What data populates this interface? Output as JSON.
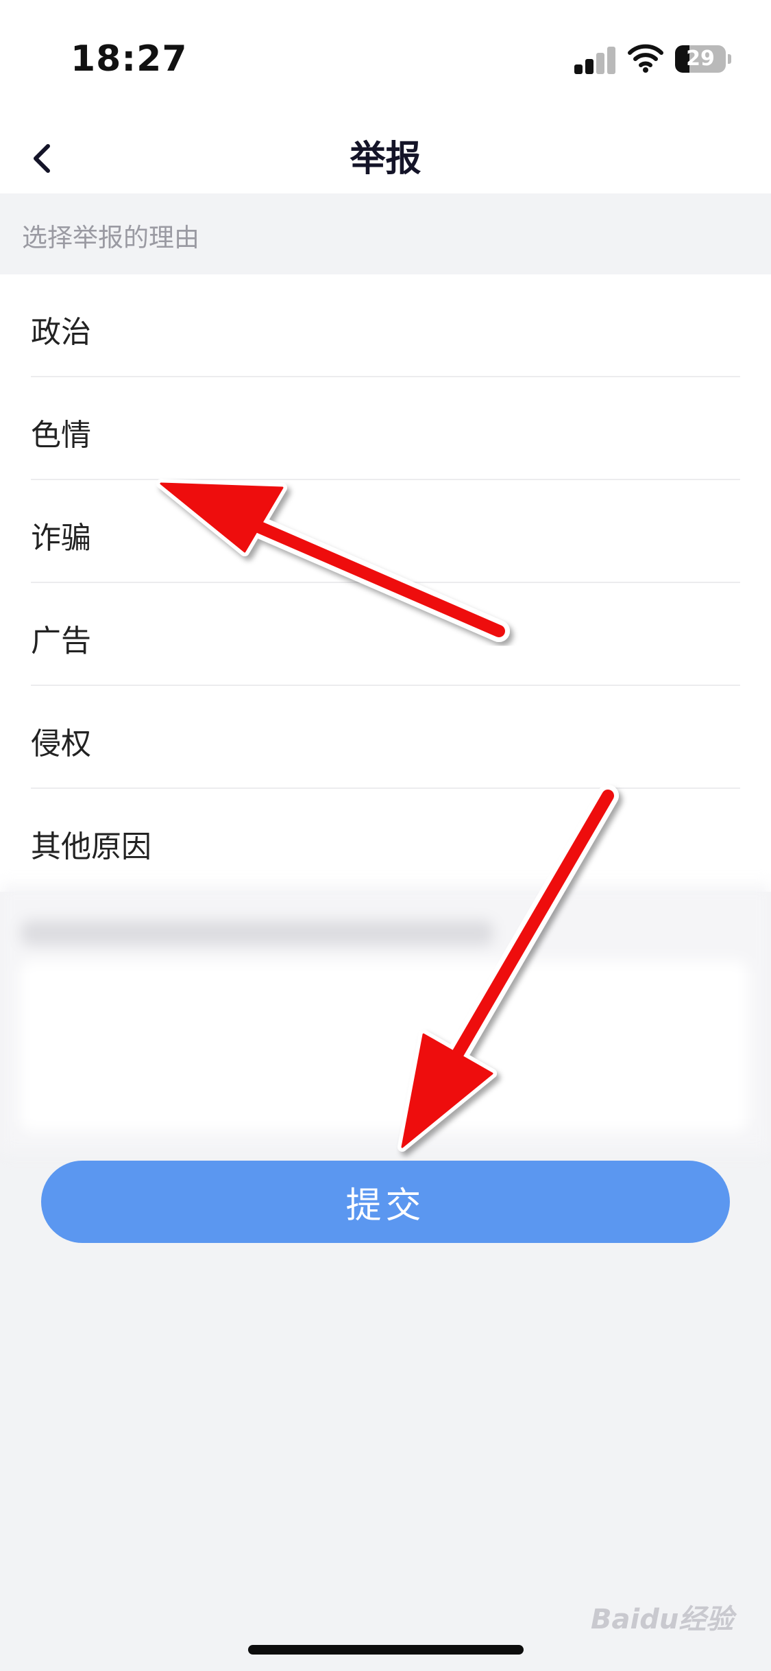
{
  "status_bar": {
    "time": "18:27",
    "battery_level": "29",
    "signal_icon": "signal-icon",
    "wifi_icon": "wifi-icon",
    "battery_icon": "battery-icon"
  },
  "nav": {
    "title": "举报",
    "back_icon": "chevron-left-icon"
  },
  "section_hint": "选择举报的理由",
  "reasons": [
    {
      "label": "政治"
    },
    {
      "label": "色情"
    },
    {
      "label": "诈骗"
    },
    {
      "label": "广告"
    },
    {
      "label": "侵权"
    },
    {
      "label": "其他原因"
    }
  ],
  "submit_label": "提交",
  "watermark": "Baidu经验",
  "colors": {
    "accent": "#5b97f0",
    "annotation_arrow": "#ee1111",
    "background": "#f2f3f5"
  }
}
